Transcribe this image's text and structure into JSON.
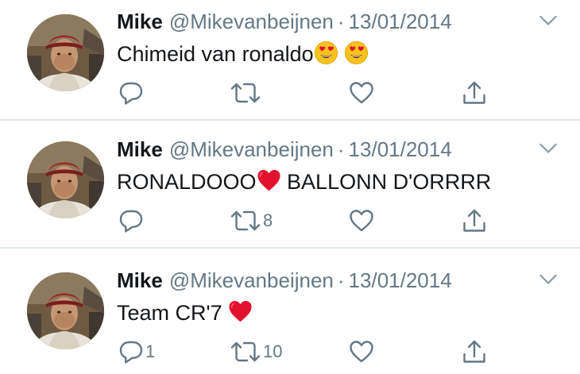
{
  "tweets": [
    {
      "name": "Mike",
      "handle": "@Mikevanbeijnen",
      "separator": "·",
      "date": "13/01/2014",
      "text": "Chimeid van ronaldo",
      "emojis": [
        "heart-eyes-emoji",
        "heart-eyes-emoji"
      ],
      "reply_count": "",
      "retweet_count": "",
      "like_count": ""
    },
    {
      "name": "Mike",
      "handle": "@Mikevanbeijnen",
      "separator": "·",
      "date": "13/01/2014",
      "text_before": "RONALDOOO",
      "text_after": " BALLONN D'ORRRR",
      "emojis": [
        "red-heart-emoji"
      ],
      "reply_count": "",
      "retweet_count": "8",
      "like_count": ""
    },
    {
      "name": "Mike",
      "handle": "@Mikevanbeijnen",
      "separator": "·",
      "date": "13/01/2014",
      "text": "Team CR'7 ",
      "emojis": [
        "red-heart-emoji"
      ],
      "reply_count": "1",
      "retweet_count": "10",
      "like_count": ""
    }
  ],
  "icons": {
    "reply": "speech-bubble-icon",
    "retweet": "retweet-arrows-icon",
    "like": "heart-outline-icon",
    "share": "upload-share-icon",
    "menu": "chevron-down-icon"
  },
  "colors": {
    "text": "#14171a",
    "secondary": "#657786",
    "divider": "#e1e8ed",
    "emoji_face": "#f7c21f",
    "emoji_heart": "#e2122e"
  }
}
